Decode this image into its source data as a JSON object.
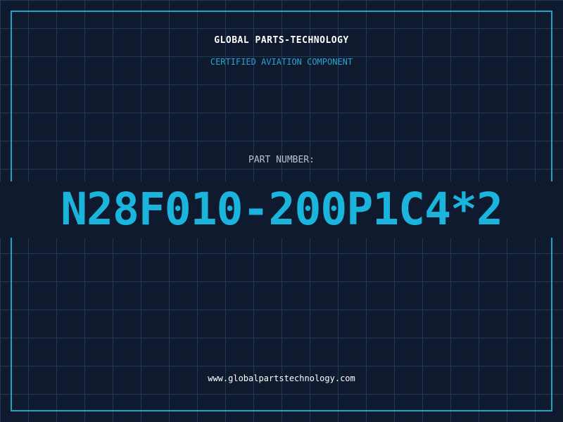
{
  "header": {
    "company_name": "GLOBAL PARTS-TECHNOLOGY",
    "subtitle": "CERTIFIED AVIATION COMPONENT"
  },
  "part": {
    "label": "PART NUMBER:",
    "number": "N28F010-200P1C4*2"
  },
  "footer": {
    "url": "www.globalpartstechnology.com"
  },
  "colors": {
    "background": "#0f1a2e",
    "grid": "#1c3b55",
    "accent": "#1ab4dc",
    "frame": "#1fa3c9"
  }
}
